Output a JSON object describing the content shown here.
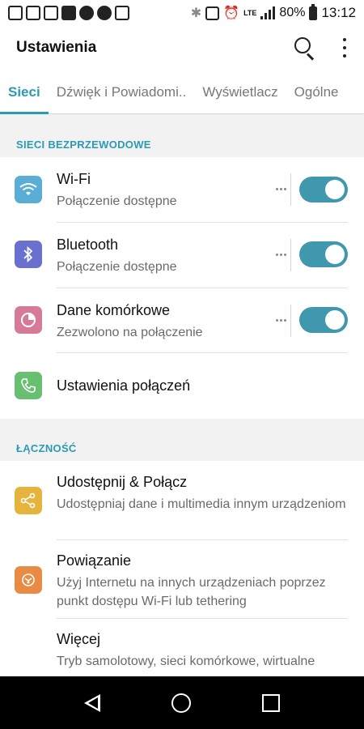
{
  "status_bar": {
    "left_icons": [
      "notification-app-icon",
      "notification-app-icon",
      "notification-app-icon",
      "office-icon",
      "android-robot-icon",
      "navigation-icon",
      "maps-icon",
      "bluetooth-icon",
      "nfc-icon",
      "alarm-icon",
      "lte-icon"
    ],
    "battery_percent": "80%",
    "time": "13:12"
  },
  "app_bar": {
    "title": "Ustawienia"
  },
  "tabs": [
    {
      "label": "Sieci"
    },
    {
      "label": "Dźwięk i Powiadomi.."
    },
    {
      "label": "Wyświetlacz"
    },
    {
      "label": "Ogólne"
    }
  ],
  "sections": {
    "wireless": {
      "header": "SIECI BEZPRZEWODOWE"
    },
    "connectivity": {
      "header": "ŁĄCZNOŚĆ"
    }
  },
  "rows": {
    "wifi": {
      "title": "Wi-Fi",
      "subtitle": "Połączenie dostępne",
      "toggle": "on",
      "icon_color": "#5aaed6"
    },
    "bluetooth": {
      "title": "Bluetooth",
      "subtitle": "Połączenie dostępne",
      "toggle": "on",
      "icon_color": "#6a70d0"
    },
    "mobile_data": {
      "title": "Dane komórkowe",
      "subtitle": "Zezwolono na połączenie",
      "toggle": "on",
      "icon_color": "#d77a97"
    },
    "call_settings": {
      "title": "Ustawienia połączeń",
      "icon_color": "#68bf70"
    },
    "share_connect": {
      "title": "Udostępnij & Połącz",
      "subtitle": "Udostępniaj dane i multimedia innym urządzeniom",
      "icon_color": "#e6b43c"
    },
    "tethering": {
      "title": "Powiązanie",
      "subtitle": "Użyj Internetu na innych urządzeniach poprzez punkt dostępu Wi-Fi lub tethering",
      "icon_color": "#ea8b45"
    },
    "more": {
      "title": "Więcej",
      "subtitle": "Tryb samolotowy, sieci komórkowe, wirtualne"
    }
  },
  "colors": {
    "accent": "#2a9ab5",
    "toggle_on": "#3f98ad"
  }
}
